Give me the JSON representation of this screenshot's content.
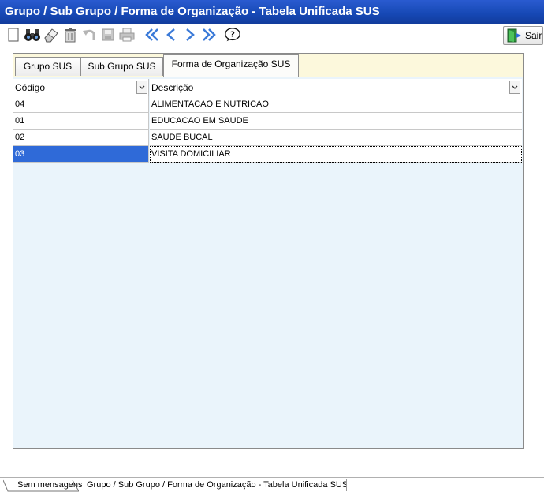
{
  "window": {
    "title": "Grupo / Sub Grupo  / Forma de Organização - Tabela Unificada SUS"
  },
  "toolbar": {
    "buttons": [
      {
        "icon": "new-document-icon"
      },
      {
        "icon": "binoculars-icon"
      },
      {
        "icon": "eraser-icon"
      },
      {
        "icon": "trash-icon"
      },
      {
        "icon": "undo-icon"
      },
      {
        "icon": "save-disk-icon"
      },
      {
        "icon": "printer-icon"
      },
      {
        "icon": "first-record-icon"
      },
      {
        "icon": "previous-record-icon"
      },
      {
        "icon": "next-record-icon"
      },
      {
        "icon": "last-record-icon"
      },
      {
        "icon": "help-icon"
      }
    ],
    "exit_label": "Sair"
  },
  "tabs": [
    {
      "label": "Grupo SUS",
      "active": false
    },
    {
      "label": "Sub Grupo SUS",
      "active": false
    },
    {
      "label": "Forma de Organização SUS",
      "active": true
    }
  ],
  "grid": {
    "columns": [
      "Código",
      "Descrição"
    ],
    "rows": [
      {
        "code": "04",
        "description": "ALIMENTACAO E NUTRICAO"
      },
      {
        "code": "01",
        "description": "EDUCACAO EM SAUDE"
      },
      {
        "code": "02",
        "description": "SAUDE BUCAL"
      },
      {
        "code": "03",
        "description": "VISITA DOMICILIAR",
        "selected": true
      }
    ]
  },
  "status": {
    "message": "Sem mensagens",
    "screen": "Grupo / Sub Grupo  / Forma de Organização - Tabela Unificada SUS"
  },
  "colors": {
    "title_bar": "#1648b4",
    "selection": "#2f6ad8",
    "grid_bg": "#eaf4fb",
    "tab_bg": "#fcf8dc"
  }
}
